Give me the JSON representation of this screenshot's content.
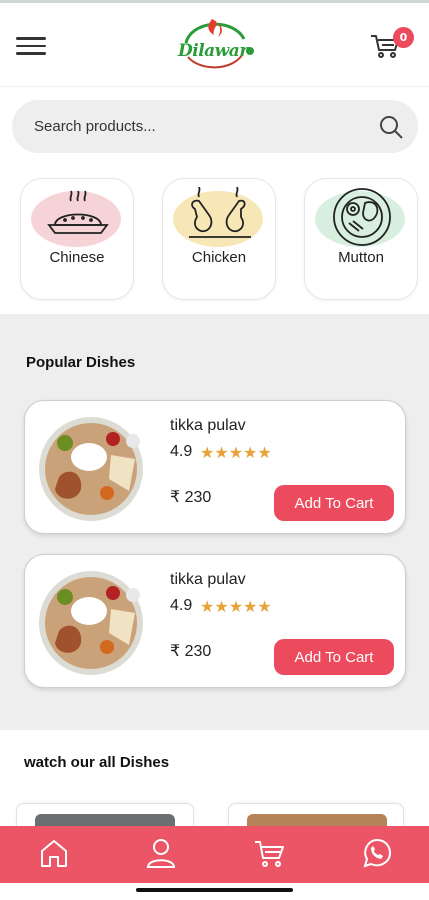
{
  "header": {
    "menu_icon": "hamburger-menu-icon",
    "logo_text": "Dilawar",
    "cart_icon": "cart-icon",
    "cart_count": "0"
  },
  "search": {
    "placeholder": "Search products...",
    "value": "",
    "icon": "search-icon"
  },
  "categories": [
    {
      "label": "Chinese",
      "icon": "food-plate-icon",
      "tint": "#f6d3d6"
    },
    {
      "label": "Chicken",
      "icon": "chicken-icon",
      "tint": "#f8e7b6"
    },
    {
      "label": "Mutton",
      "icon": "mutton-plate-icon",
      "tint": "#d8efe0"
    }
  ],
  "popular": {
    "title": "Popular Dishes",
    "items": [
      {
        "name": "tikka pulav",
        "rating": "4.9",
        "stars": 5,
        "price": "₹ 230",
        "button": "Add To Cart"
      },
      {
        "name": "tikka pulav",
        "rating": "4.9",
        "stars": 5,
        "price": "₹ 230",
        "button": "Add To Cart"
      }
    ]
  },
  "all_dishes": {
    "title": "watch our all Dishes"
  },
  "bottom_nav": [
    {
      "icon": "home-icon"
    },
    {
      "icon": "user-icon"
    },
    {
      "icon": "cart-icon"
    },
    {
      "icon": "whatsapp-icon"
    }
  ],
  "colors": {
    "accent": "#eb4b5d",
    "nav": "#eb5565",
    "star": "#e9a33b",
    "grey_bg": "#eeeeee"
  }
}
